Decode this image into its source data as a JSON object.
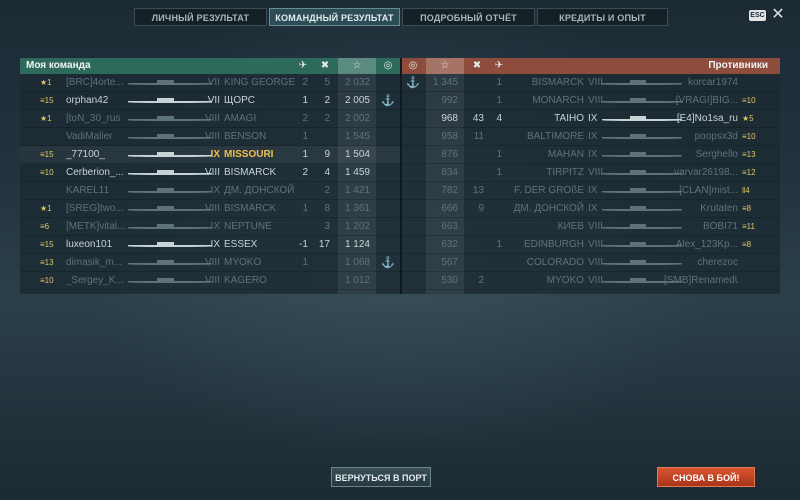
{
  "tabs": [
    {
      "label": "ЛИЧНЫЙ РЕЗУЛЬТАТ",
      "active": false
    },
    {
      "label": "КОМАНДНЫЙ РЕЗУЛЬТАТ",
      "active": true
    },
    {
      "label": "ПОДРОБНЫЙ ОТЧЁТ",
      "active": false
    },
    {
      "label": "КРЕДИТЫ И ОПЫТ",
      "active": false
    }
  ],
  "esc_label": "ESC",
  "close_icon": "close-icon",
  "left_team": {
    "title": "Моя команда",
    "columns": [
      "plane-kills-icon",
      "kills-icon",
      "☆",
      "base-icon"
    ],
    "rows": [
      {
        "rank": "★1",
        "name": "[BRC]4ortе...",
        "tier": "VII",
        "ship": "KING GEORGE V",
        "planes": "2",
        "kills": "5",
        "xp": "2 032",
        "base": "",
        "dead": true
      },
      {
        "rank": "≡15",
        "name": "orphan42",
        "tier": "VII",
        "ship": "ЩОРС",
        "planes": "1",
        "kills": "2",
        "xp": "2 005",
        "base": "⚓",
        "dead": false
      },
      {
        "rank": "★1",
        "name": "[toN_30_rus",
        "tier": "VIII",
        "ship": "AMAGI",
        "planes": "2",
        "kills": "2",
        "xp": "2 002",
        "base": "",
        "dead": true
      },
      {
        "rank": "",
        "name": "VadiMalier",
        "tier": "VIII",
        "ship": "BENSON",
        "planes": "1",
        "kills": "",
        "xp": "1 545",
        "base": "",
        "dead": true
      },
      {
        "rank": "≡15",
        "name": "_77100_",
        "tier": "IX",
        "ship": "MISSOURI",
        "planes": "1",
        "kills": "9",
        "xp": "1 504",
        "base": "",
        "dead": false,
        "player": true
      },
      {
        "rank": "≡10",
        "name": "Cerberion_...",
        "tier": "VIII",
        "ship": "BISMARCK",
        "planes": "2",
        "kills": "4",
        "xp": "1 459",
        "base": "",
        "dead": false
      },
      {
        "rank": "",
        "name": "KAREL11",
        "tier": "IX",
        "ship": "ДМ. ДОНСКОЙ",
        "planes": "",
        "kills": "2",
        "xp": "1 421",
        "base": "",
        "dead": true
      },
      {
        "rank": "★1",
        "name": "[SREG]two...",
        "tier": "VIII",
        "ship": "BISMARCK",
        "planes": "1",
        "kills": "8",
        "xp": "1 361",
        "base": "",
        "dead": true
      },
      {
        "rank": "≡6",
        "name": "[METK]vital...",
        "tier": "IX",
        "ship": "NEPTUNE",
        "planes": "",
        "kills": "3",
        "xp": "1 202",
        "base": "",
        "dead": true
      },
      {
        "rank": "≡15",
        "name": "luxeon101",
        "tier": "IX",
        "ship": "ESSEX",
        "planes": "-1",
        "kills": "17",
        "xp": "1 124",
        "base": "",
        "dead": false
      },
      {
        "rank": "≡13",
        "name": "dimasik_m...",
        "tier": "VIII",
        "ship": "MYOKO",
        "planes": "1",
        "kills": "",
        "xp": "1 068",
        "base": "⚓",
        "dead": true
      },
      {
        "rank": "≡10",
        "name": "_Sergey_K...",
        "tier": "VIII",
        "ship": "KAGERO",
        "planes": "",
        "kills": "",
        "xp": "1 012",
        "base": "",
        "dead": true
      }
    ]
  },
  "right_team": {
    "title": "Противники",
    "columns": [
      "base-icon",
      "☆",
      "kills-icon",
      "plane-kills-icon"
    ],
    "rows": [
      {
        "base": "⚓",
        "xp": "1 345",
        "kills": "",
        "planes": "1",
        "ship": "BISMARCK",
        "tier": "VIII",
        "name": "korcar1974",
        "rank": "",
        "dead": true
      },
      {
        "base": "",
        "xp": "992",
        "kills": "",
        "planes": "1",
        "ship": "MONARCH",
        "tier": "VIII",
        "name": "[VRAGI]BIG...",
        "rank": "≡10",
        "dead": true
      },
      {
        "base": "",
        "xp": "968",
        "kills": "43",
        "planes": "4",
        "ship": "TAIHO",
        "tier": "IX",
        "name": "[E4]No1sa_ru",
        "rank": "★5",
        "dead": false
      },
      {
        "base": "",
        "xp": "958",
        "kills": "11",
        "planes": "",
        "ship": "BALTIMORE",
        "tier": "IX",
        "name": "poopsx3d",
        "rank": "≡10",
        "dead": true
      },
      {
        "base": "",
        "xp": "876",
        "kills": "",
        "planes": "1",
        "ship": "MAHAN",
        "tier": "IX",
        "name": "Serghello",
        "rank": "≡13",
        "dead": true
      },
      {
        "base": "",
        "xp": "834",
        "kills": "",
        "planes": "1",
        "ship": "TIRPITZ",
        "tier": "VIII",
        "name": "varvar26198...",
        "rank": "≡12",
        "dead": true
      },
      {
        "base": "",
        "xp": "782",
        "kills": "13",
        "planes": "",
        "ship": "F. DER GROßE",
        "tier": "IX",
        "name": "[CLAN]mist...",
        "rank": "‖4",
        "dead": true
      },
      {
        "base": "",
        "xp": "666",
        "kills": "9",
        "planes": "",
        "ship": "ДМ. ДОНСКОЙ",
        "tier": "IX",
        "name": "Krutaten",
        "rank": "≡8",
        "dead": true
      },
      {
        "base": "",
        "xp": "663",
        "kills": "",
        "planes": "",
        "ship": "КИЕВ",
        "tier": "VIII",
        "name": "BOBI71",
        "rank": "≡11",
        "dead": true
      },
      {
        "base": "",
        "xp": "632",
        "kills": "",
        "planes": "1",
        "ship": "EDINBURGH",
        "tier": "VIII",
        "name": "Alex_123Kp...",
        "rank": "≡8",
        "dead": true
      },
      {
        "base": "",
        "xp": "567",
        "kills": "",
        "planes": "",
        "ship": "COLORADO",
        "tier": "VIII",
        "name": "cherezoc",
        "rank": "",
        "dead": true
      },
      {
        "base": "",
        "xp": "530",
        "kills": "2",
        "planes": "",
        "ship": "MYOKO",
        "tier": "VIII",
        "name": "[SMB]RenamedU...",
        "rank": "",
        "dead": true
      }
    ]
  },
  "buttons": {
    "port": "ВЕРНУТЬСЯ В ПОРТ",
    "battle": "СНОВА В БОЙ!"
  },
  "colors": {
    "ally_header": "#2e6a5c",
    "enemy_header": "#8e4d3c",
    "gold": "#f0c04a",
    "battle_button": "#c84426"
  }
}
